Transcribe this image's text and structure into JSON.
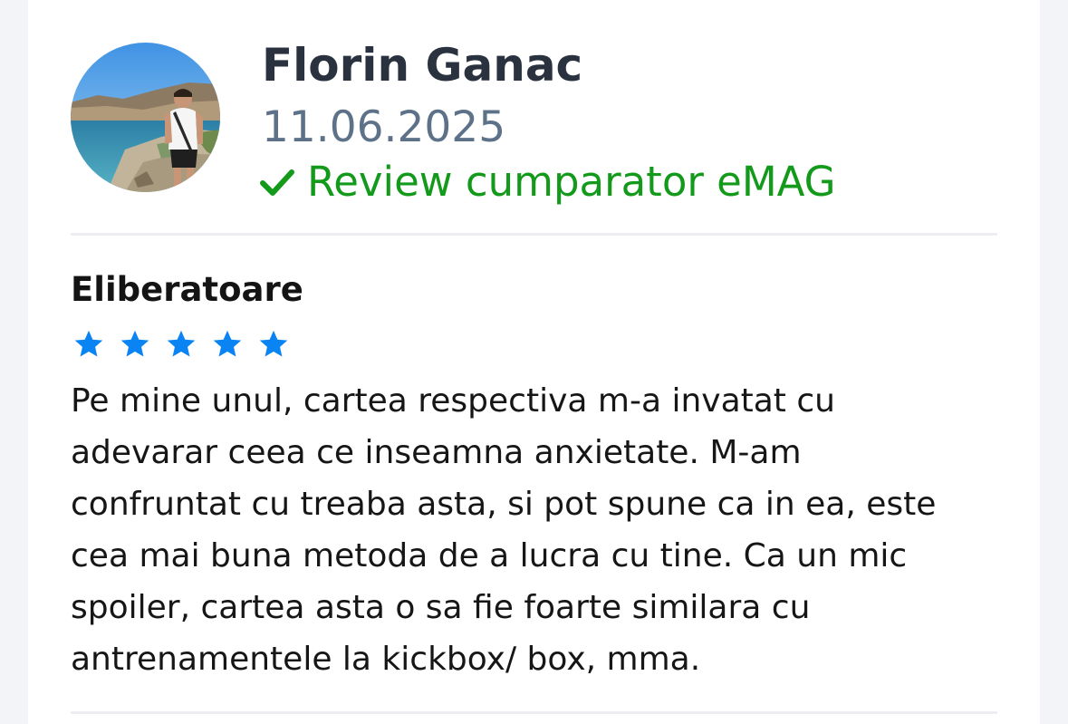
{
  "review": {
    "author": "Florin Ganac",
    "date": "11.06.2025",
    "verified_label": "Review cumparator eMAG",
    "title": "Eliberatoare",
    "rating": 5,
    "rating_max": 5,
    "body_lines": [
      "Pe mine unul, cartea respectiva m-a invatat cu",
      "adevarar ceea ce inseamna anxietate. M-am",
      "confruntat cu treaba asta, si pot spune ca in ea, este",
      "cea mai buna metoda de a lucra cu tine. Ca un mic",
      "spoiler, cartea asta o sa fie foarte similara cu",
      "antrenamentele la kickbox/ box, mma."
    ]
  },
  "icons": {
    "verified": "check-icon",
    "rating": "star-icon"
  },
  "colors": {
    "author": "#2a3240",
    "date": "#5d7289",
    "verified": "#139a1b",
    "star": "#0b84f3",
    "text": "#161616",
    "card_background": "#ffffff",
    "page_background": "#f2f4f8"
  }
}
